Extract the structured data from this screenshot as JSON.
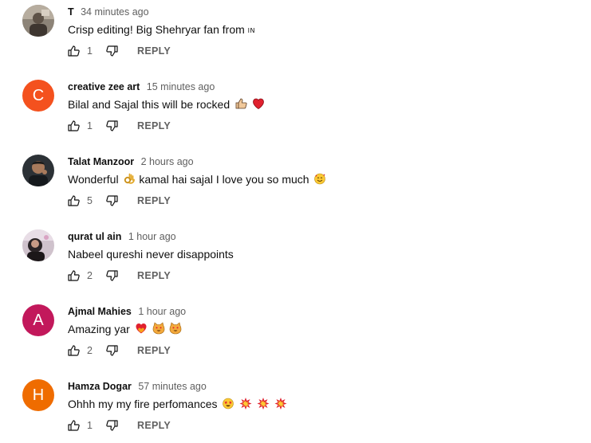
{
  "comments": [
    {
      "author": "T",
      "time": "34 minutes ago",
      "text": "Crisp editing! Big Shehryar fan from",
      "flag": "IN",
      "likes": "1",
      "reply": "REPLY",
      "avatar": "photo"
    },
    {
      "author": "creative zee art",
      "time": "15 minutes ago",
      "text": "Bilal and Sajal this will be rocked",
      "emoji": [
        "thumbs-up-icon",
        "red-heart-icon"
      ],
      "likes": "1",
      "reply": "REPLY",
      "avatar": "C",
      "avatar_color": "#f4511e"
    },
    {
      "author": "Talat Manzoor",
      "time": "2 hours ago",
      "text_a": "Wonderful",
      "text_b": "kamal hai sajal I love you so much",
      "emoji": [
        "ok-hand-icon",
        "smiling-face-with-hearts-icon"
      ],
      "likes": "5",
      "reply": "REPLY",
      "avatar": "photo"
    },
    {
      "author": "qurat ul ain",
      "time": "1 hour ago",
      "text": "Nabeel qureshi never disappoints",
      "likes": "2",
      "reply": "REPLY",
      "avatar": "photo"
    },
    {
      "author": "Ajmal Mahies",
      "time": "1 hour ago",
      "text": "Amazing yar",
      "emoji": [
        "heart-on-fire-icon",
        "heart-eyes-cat-icon",
        "heart-eyes-cat-icon"
      ],
      "likes": "2",
      "reply": "REPLY",
      "avatar": "A",
      "avatar_color": "#c2185b"
    },
    {
      "author": "Hamza Dogar",
      "time": "57 minutes ago",
      "text": "Ohhh my my fire perfomances",
      "emoji": [
        "star-struck-icon",
        "collision-icon",
        "collision-icon",
        "collision-icon"
      ],
      "likes": "1",
      "reply": "REPLY",
      "avatar": "H",
      "avatar_color": "#ef6c00"
    }
  ]
}
